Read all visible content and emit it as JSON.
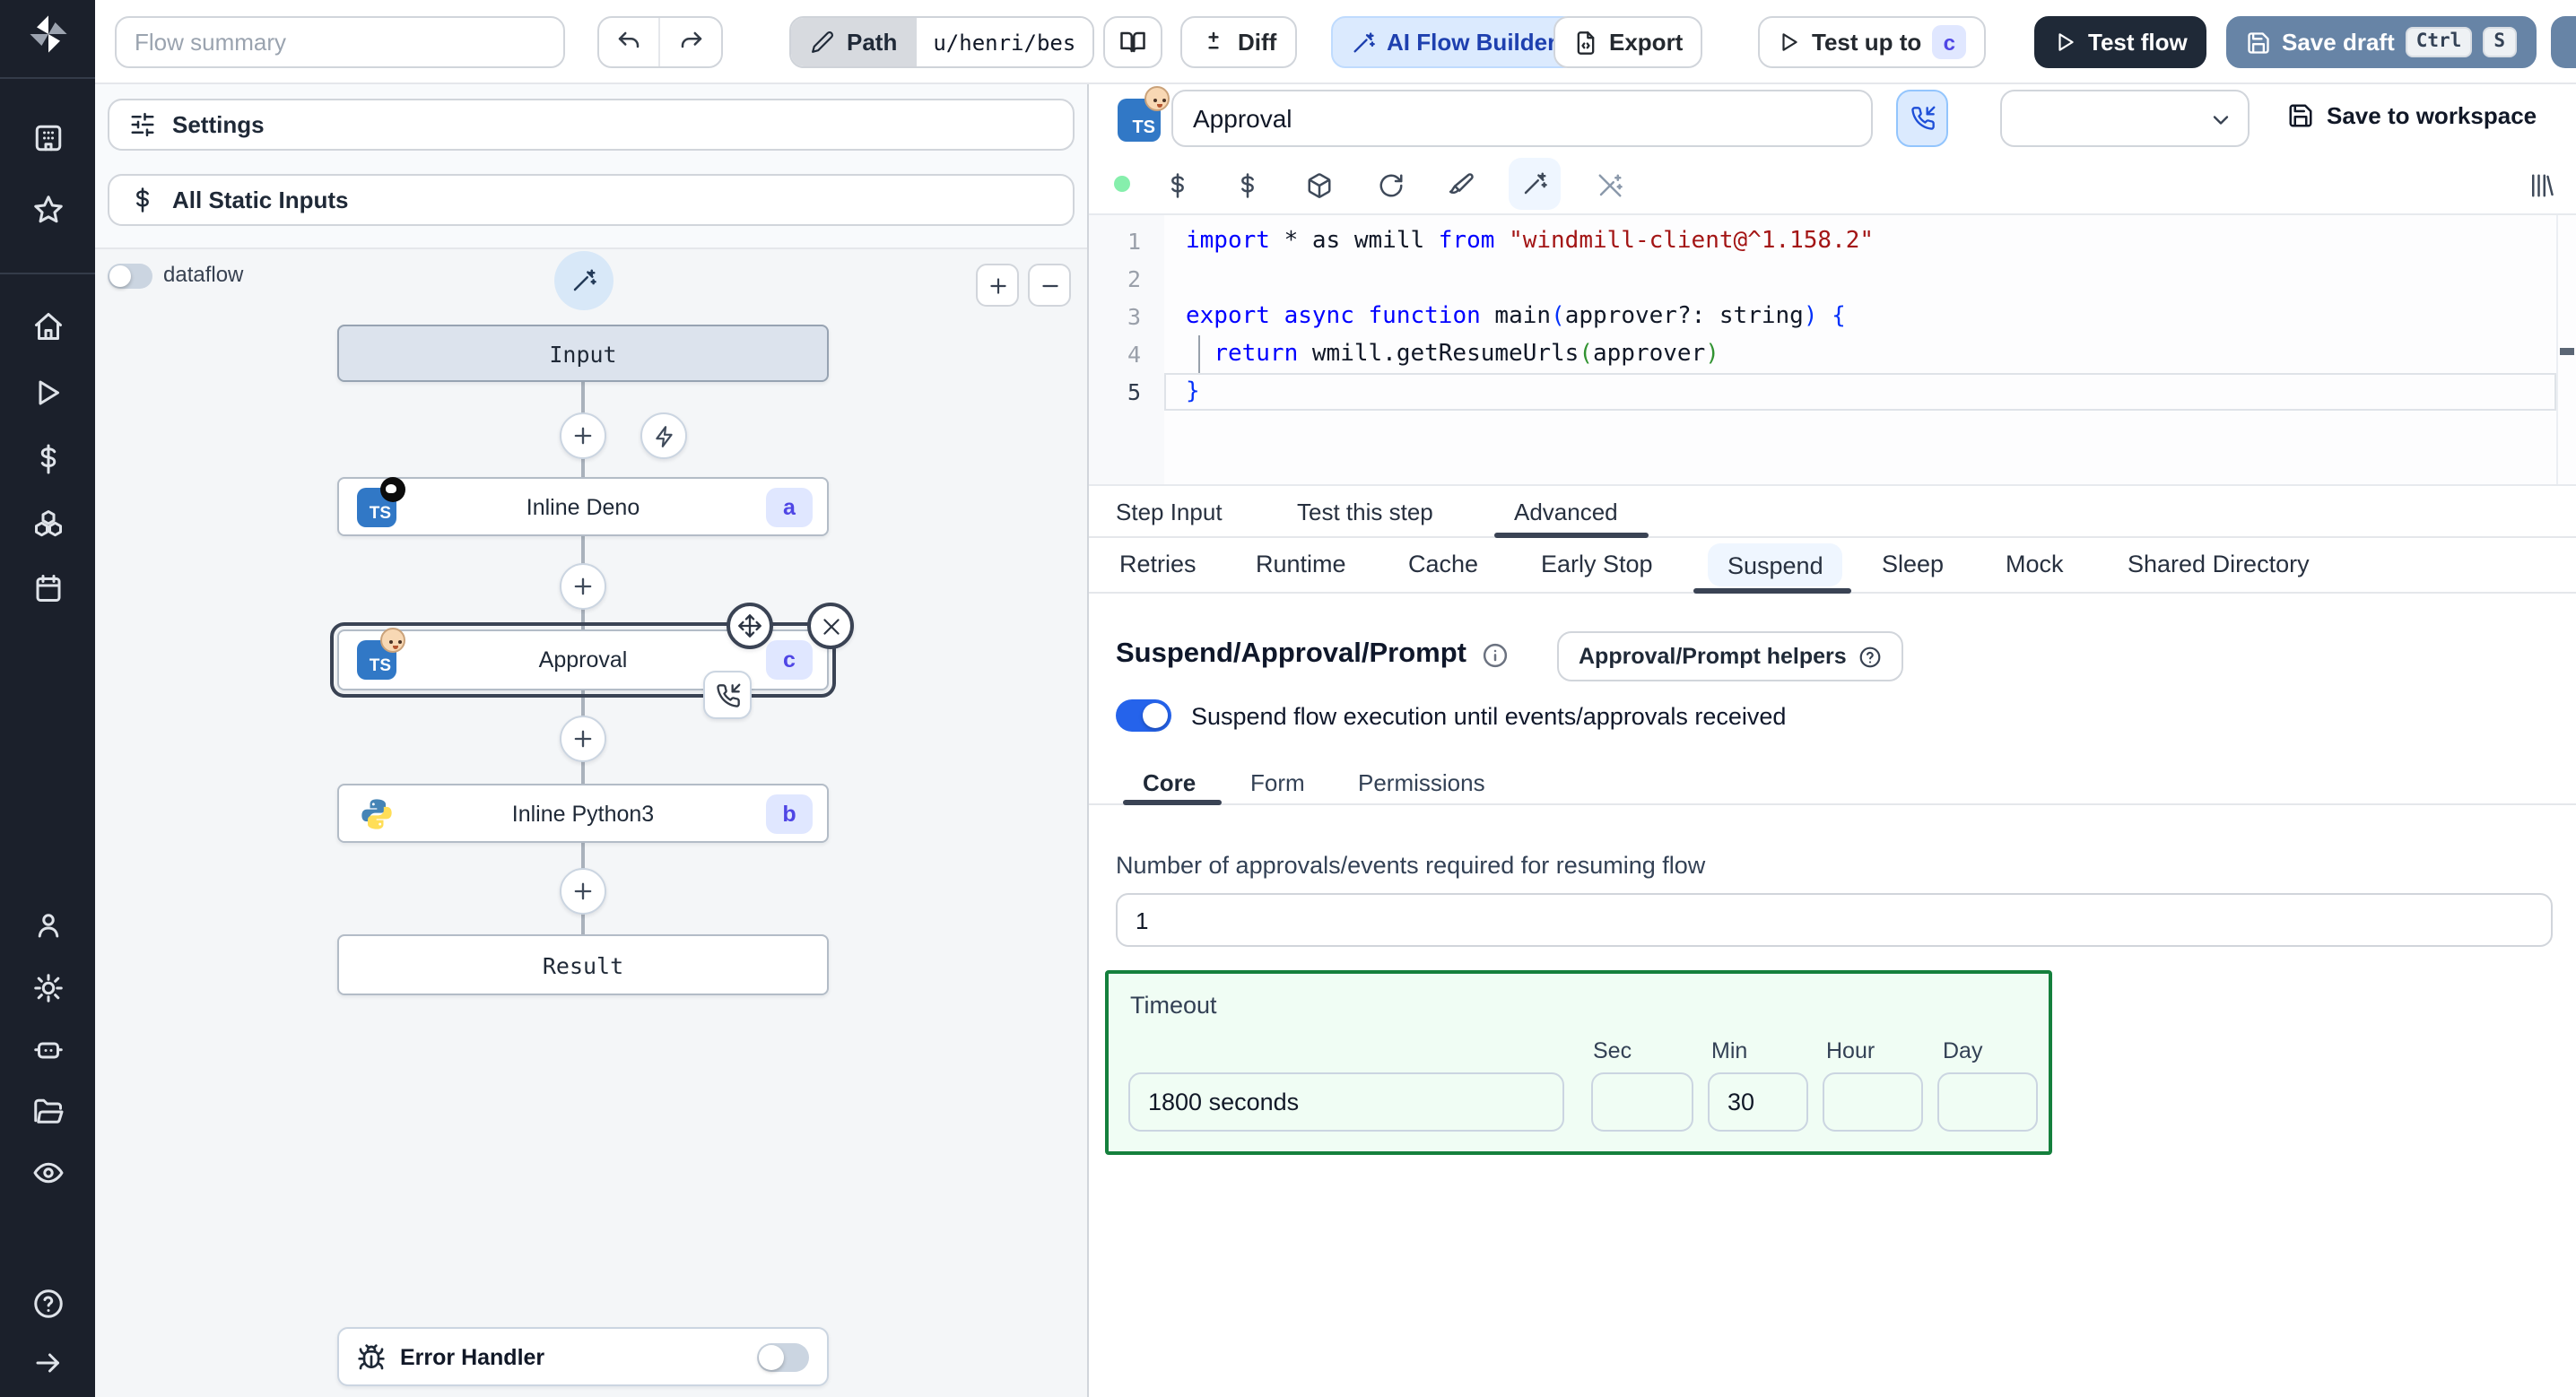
{
  "topbar": {
    "flow_summary_placeholder": "Flow summary",
    "path": {
      "label": "Path",
      "value": "u/henri/bes"
    },
    "diff_label": "Diff",
    "ai_flow_builder_label": "AI Flow Builder",
    "export_label": "Export",
    "test_up_to": {
      "label": "Test up to",
      "badge": "c"
    },
    "test_flow_label": "Test flow",
    "save_draft": {
      "label": "Save draft",
      "kbd_ctrl": "Ctrl",
      "kbd_s": "S"
    }
  },
  "flow_panel": {
    "settings_label": "Settings",
    "all_static_inputs_label": "All Static Inputs",
    "dataflow_label": "dataflow",
    "nodes": {
      "input": {
        "label": "Input"
      },
      "deno": {
        "label": "Inline Deno",
        "badge": "a"
      },
      "approval": {
        "label": "Approval",
        "badge": "c",
        "selected": true
      },
      "python": {
        "label": "Inline Python3",
        "badge": "b"
      },
      "result": {
        "label": "Result"
      }
    },
    "error_handler_label": "Error Handler"
  },
  "step_editor": {
    "name_value": "Approval",
    "save_to_workspace_label": "Save to workspace",
    "active_line": 5,
    "code_lines": [
      {
        "n": "1",
        "parts": [
          {
            "t": "import",
            "c": "kw"
          },
          {
            "t": " * as wmill ",
            "c": "pl"
          },
          {
            "t": "from",
            "c": "kw"
          },
          {
            "t": " ",
            "c": "pl"
          },
          {
            "t": "\"windmill-client@^1.158.2\"",
            "c": "str"
          }
        ]
      },
      {
        "n": "2",
        "parts": []
      },
      {
        "n": "3",
        "parts": [
          {
            "t": "export",
            "c": "kw"
          },
          {
            "t": " ",
            "c": "pl"
          },
          {
            "t": "async",
            "c": "kw"
          },
          {
            "t": " ",
            "c": "pl"
          },
          {
            "t": "function",
            "c": "kw"
          },
          {
            "t": " main",
            "c": "pl"
          },
          {
            "t": "(",
            "c": "b1"
          },
          {
            "t": "approver?: string",
            "c": "pl"
          },
          {
            "t": ")",
            "c": "b1"
          },
          {
            "t": " ",
            "c": "pl"
          },
          {
            "t": "{",
            "c": "b1"
          }
        ]
      },
      {
        "n": "4",
        "parts": [
          {
            "t": "  ",
            "c": "pl"
          },
          {
            "t": "return",
            "c": "kw"
          },
          {
            "t": " wmill.getResumeUrls",
            "c": "pl"
          },
          {
            "t": "(",
            "c": "b2"
          },
          {
            "t": "approver",
            "c": "pl"
          },
          {
            "t": ")",
            "c": "b2"
          }
        ]
      },
      {
        "n": "5",
        "parts": [
          {
            "t": "}",
            "c": "b1"
          }
        ],
        "active": true
      }
    ]
  },
  "tabs": {
    "step_tabs": [
      {
        "label": "Step Input"
      },
      {
        "label": "Test this step"
      },
      {
        "label": "Advanced",
        "active": true
      }
    ],
    "advanced_tabs": [
      {
        "label": "Retries"
      },
      {
        "label": "Runtime"
      },
      {
        "label": "Cache"
      },
      {
        "label": "Early Stop"
      },
      {
        "label": "Suspend",
        "active": true
      },
      {
        "label": "Sleep"
      },
      {
        "label": "Mock"
      },
      {
        "label": "Shared Directory"
      }
    ]
  },
  "suspend": {
    "title": "Suspend/Approval/Prompt",
    "helpers_button_label": "Approval/Prompt helpers",
    "toggle_label": "Suspend flow execution until events/approvals received",
    "toggle_on": true,
    "sub_tabs": [
      {
        "label": "Core",
        "active": true
      },
      {
        "label": "Form"
      },
      {
        "label": "Permissions"
      }
    ],
    "approvals_label": "Number of approvals/events required for resuming flow",
    "approvals_value": "1",
    "timeout": {
      "label": "Timeout",
      "display_value": "1800 seconds",
      "columns": [
        "Sec",
        "Min",
        "Hour",
        "Day"
      ],
      "values": {
        "sec": "",
        "min": "30",
        "hour": "",
        "day": ""
      }
    }
  },
  "colors": {
    "accent_blue": "#2563eb",
    "badge_bg": "#e0e7ff",
    "badge_text": "#4f46e5",
    "timeout_border": "#15803d",
    "toggle_on": "#2563eb",
    "save_draft_bg": "#6784a6",
    "test_flow_bg": "#1f2937",
    "ai_builder_bg": "#dbeafe",
    "status_dot": "#86efac"
  }
}
